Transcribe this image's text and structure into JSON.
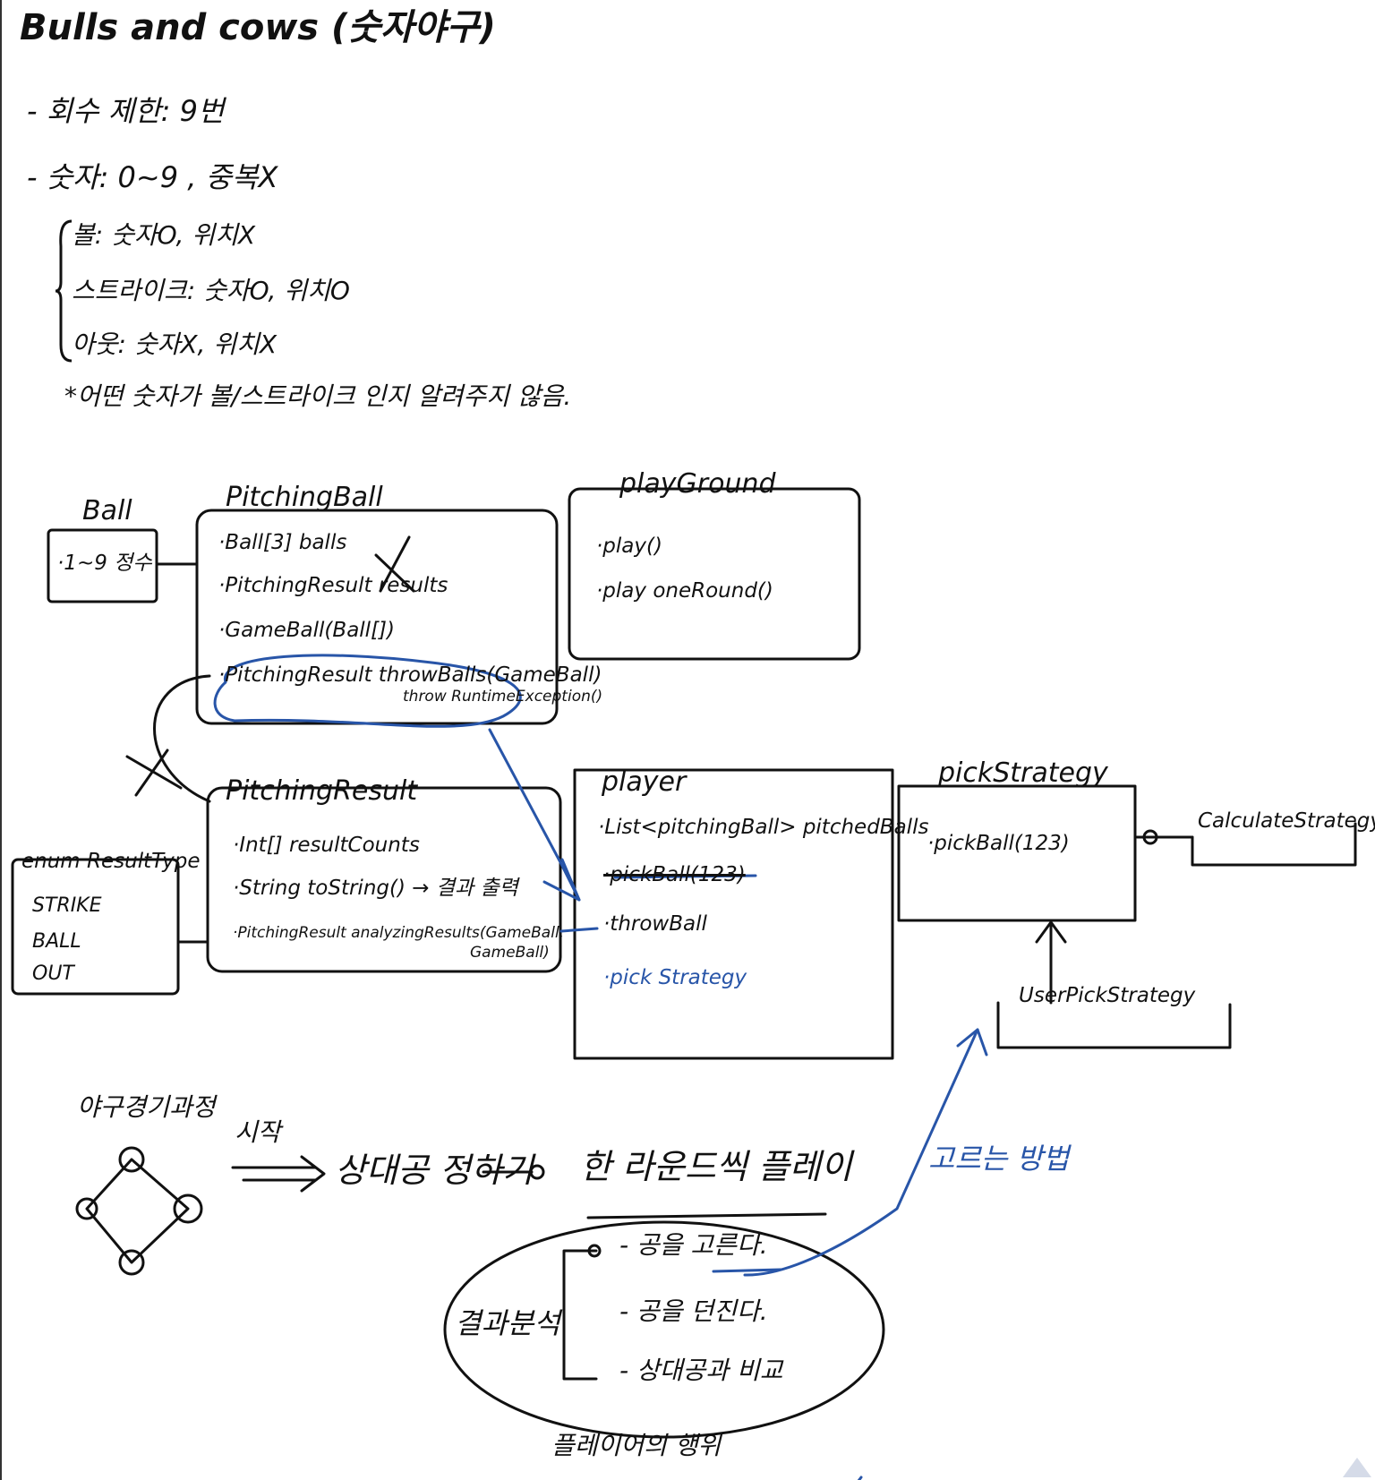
{
  "title": "Bulls and cows (숫자야구)",
  "rules": {
    "attempts": "- 회수 제한: 9번",
    "digits": "- 숫자: 0~9 , 중복X",
    "ball": "볼: 숫자O, 위치X",
    "strike": "스트라이크: 숫자O, 위치O",
    "out": "아웃: 숫자X, 위치X",
    "note": "*어떤 숫자가 볼/스트라이크 인지 알려주지 않음."
  },
  "classes": {
    "ball": {
      "title": "Ball",
      "members": [
        "·1~9 정수"
      ]
    },
    "pitching_ball": {
      "title": "PitchingBall",
      "members": [
        "·Ball[3] balls",
        "·PitchingResult results",
        "·GameBall(Ball[])",
        "·PitchingResult throwBalls(GameBall)"
      ],
      "exception": "throw RuntimeException()"
    },
    "playground": {
      "title": "playGround",
      "members": [
        "·play()",
        "·play oneRound()"
      ]
    },
    "pitching_result": {
      "title": "PitchingResult",
      "members": [
        "·Int[] resultCounts",
        "·String toString() → 결과 출력",
        "·PitchingResult analyzingResults(GameBall,",
        "GameBall)"
      ]
    },
    "result_type": {
      "title": "enum ResultType",
      "items": [
        "STRIKE",
        "BALL",
        "OUT"
      ]
    },
    "player": {
      "title": "player",
      "members": [
        "·List<pitchingBall> pitchedBalls",
        "·pickBall(123)",
        "·throwBall",
        "·pick Strategy"
      ]
    },
    "pick_strategy": {
      "title": "pickStrategy",
      "members": [
        "·pickBall(123)"
      ]
    },
    "calculate_strategy": {
      "title": "CalculateStrategy"
    },
    "user_pick_strategy": {
      "title": "UserPickStrategy"
    }
  },
  "flow": {
    "loop_label": "야구경기과정",
    "start_label": "시작",
    "step1": "상대공 정하기",
    "step2": "한 라운드씩 플레이",
    "analysis_label": "결과분석",
    "sub_steps": [
      "- 공을 고른다.",
      "- 공을 던진다.",
      "- 상대공과 비교"
    ],
    "player_role": "플레이어의 행위",
    "choose_method": "고르는 방법"
  },
  "colors": {
    "ink": "#111111",
    "blue_ink": "#2855a8"
  }
}
